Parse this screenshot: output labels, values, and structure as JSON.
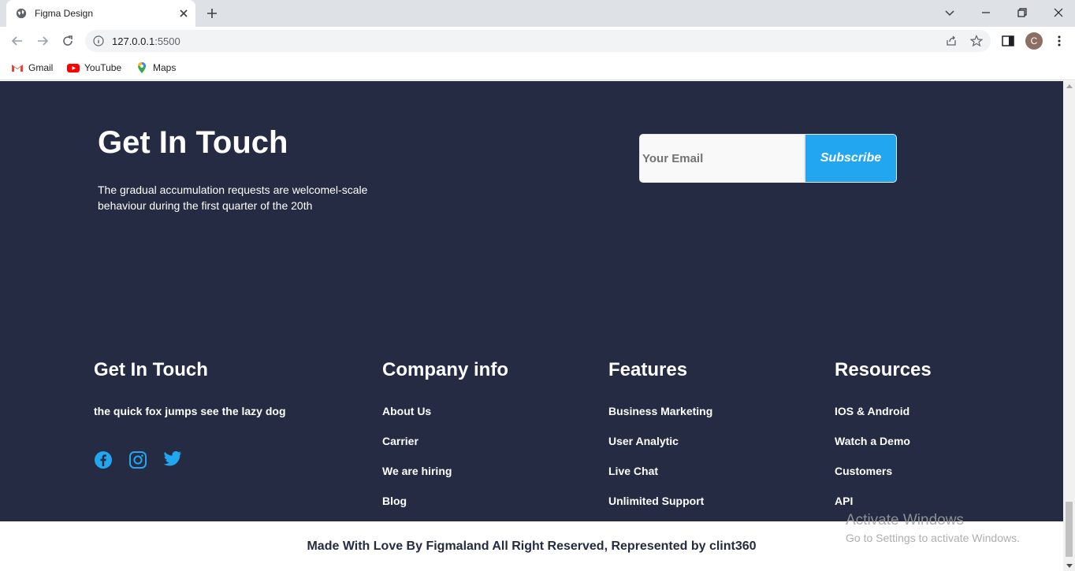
{
  "browser": {
    "tab_title": "Figma Design",
    "url_host": "127.0.0.1",
    "url_port": ":5500",
    "profile_initial": "C",
    "bookmarks": [
      {
        "label": "Gmail",
        "icon": "gmail-icon"
      },
      {
        "label": "YouTube",
        "icon": "youtube-icon"
      },
      {
        "label": "Maps",
        "icon": "maps-icon"
      }
    ]
  },
  "hero": {
    "title": "Get In Touch",
    "text": "The gradual accumulation requests are welcomel-scale behaviour during the first quarter of the 20th",
    "email_placeholder": "Your Email",
    "subscribe_label": "Subscribe"
  },
  "footer": {
    "touch": {
      "title": "Get In Touch",
      "subtitle": "the quick fox jumps see the lazy dog"
    },
    "company": {
      "title": "Company info",
      "links": [
        "About Us",
        "Carrier",
        "We are hiring",
        "Blog"
      ]
    },
    "features": {
      "title": "Features",
      "links": [
        "Business Marketing",
        "User Analytic",
        "Live Chat",
        "Unlimited Support"
      ]
    },
    "resources": {
      "title": "Resources",
      "links": [
        "IOS & Android",
        "Watch a Demo",
        "Customers",
        "API"
      ]
    },
    "copyright": "Made With Love By Figmaland All Right Reserved, Represented by clint360"
  },
  "overlay": {
    "title": "Activate Windows",
    "subtitle": "Go to Settings to activate Windows."
  },
  "colors": {
    "dark_bg": "#252b42",
    "accent": "#23a6f0",
    "white": "#ffffff"
  }
}
